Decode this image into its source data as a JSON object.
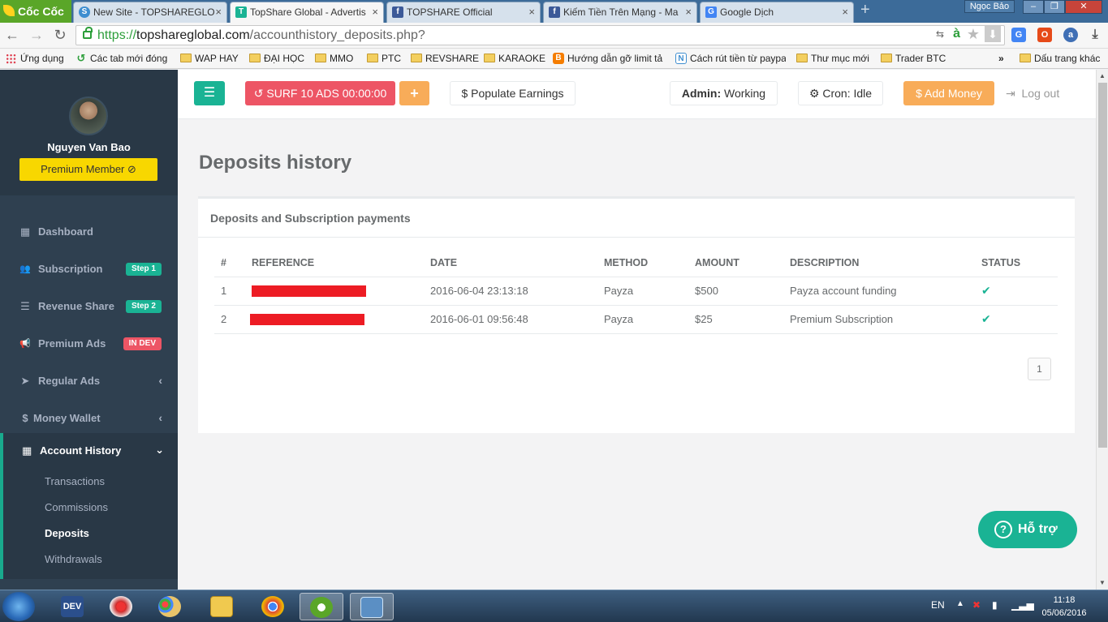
{
  "browser": {
    "brand": "Cốc Cốc",
    "tabs": [
      {
        "title": "New Site - TOPSHAREGLO",
        "fav": "S",
        "color": "#3e8ed0",
        "active": false
      },
      {
        "title": "TopShare Global - Advertis",
        "fav": "T",
        "color": "#1ab394",
        "active": true
      },
      {
        "title": "TOPSHARE Official",
        "fav": "f",
        "color": "#3b5998",
        "active": false
      },
      {
        "title": "Kiếm Tiền Trên Mạng - Ma",
        "fav": "f",
        "color": "#3b5998",
        "active": false
      },
      {
        "title": "Google Dịch",
        "fav": "G",
        "color": "#4285f4",
        "active": false
      }
    ],
    "window_user": "Ngọc Bảo",
    "url_scheme": "https://",
    "url_host": "topshareglobal.com",
    "url_path": "/accounthistory_deposits.php?",
    "bookmarks": [
      {
        "label": "Ứng dụng",
        "kind": "apps"
      },
      {
        "label": "Các tab mới đóng",
        "kind": "history"
      },
      {
        "label": "WAP HAY",
        "kind": "folder"
      },
      {
        "label": "ĐẠI HỌC",
        "kind": "folder"
      },
      {
        "label": "MMO",
        "kind": "folder"
      },
      {
        "label": "PTC",
        "kind": "folder"
      },
      {
        "label": "REVSHARE",
        "kind": "folder"
      },
      {
        "label": "KARAOKE",
        "kind": "folder"
      },
      {
        "label": "Hướng dẫn gỡ limit tả",
        "kind": "blogger"
      },
      {
        "label": "Cách rút tiền từ paypa",
        "kind": "link"
      },
      {
        "label": "Thư mục mới",
        "kind": "folder"
      },
      {
        "label": "Trader BTC",
        "kind": "folder"
      }
    ],
    "bookmarks_more": "»",
    "other_bookmarks": "Dấu trang khác"
  },
  "sidebar": {
    "user_name": "Nguyen Van Bao",
    "member_badge": "Premium Member",
    "menu": [
      {
        "label": "Dashboard",
        "icon": "dashboard-icon",
        "glyph": "▦",
        "badge": ""
      },
      {
        "label": "Subscription",
        "icon": "users-icon",
        "glyph": "👥",
        "badge": "Step 1",
        "badge_color": "green"
      },
      {
        "label": "Revenue Share",
        "icon": "list-icon",
        "glyph": "☰",
        "badge": "Step 2",
        "badge_color": "green"
      },
      {
        "label": "Premium Ads",
        "icon": "bullhorn-icon",
        "glyph": "📢",
        "badge": "IN DEV",
        "badge_color": "red"
      },
      {
        "label": "Regular Ads",
        "icon": "paper-plane-icon",
        "glyph": "➤",
        "chevron": "‹"
      },
      {
        "label": "Money Wallet",
        "icon": "dollar-icon",
        "glyph": "$",
        "chevron": "‹"
      }
    ],
    "active_section": {
      "label": "Account History",
      "chevron": "⌄",
      "items": [
        "Transactions",
        "Commissions",
        "Deposits",
        "Withdrawals"
      ],
      "current": "Deposits"
    }
  },
  "topnav": {
    "surf_label": "SURF 10 ADS 00:00:00",
    "plus_label": "+",
    "populate_label": "Populate Earnings",
    "admin_key": "Admin:",
    "admin_value": "Working",
    "cron_label": "Cron: Idle",
    "add_money_label": "Add Money",
    "logout_label": "Log out"
  },
  "page": {
    "title": "Deposits history",
    "panel_title": "Deposits and Subscription payments",
    "columns": [
      "#",
      "REFERENCE",
      "DATE",
      "METHOD",
      "AMOUNT",
      "DESCRIPTION",
      "STATUS"
    ],
    "rows": [
      {
        "num": "1",
        "reference": "",
        "date": "2016-06-04 23:13:18",
        "method": "Payza",
        "amount": "$500",
        "description": "Payza account funding",
        "status": "✔"
      },
      {
        "num": "2",
        "reference": "",
        "date": "2016-06-01 09:56:48",
        "method": "Payza",
        "amount": "$25",
        "description": "Premium Subscription",
        "status": "✔"
      }
    ],
    "pagination_current": "1",
    "support_label": "Hỗ trợ",
    "support_glyph": "?"
  },
  "taskbar": {
    "apps": [
      "DEV C++",
      "CCleaner",
      "Paint",
      "Explorer",
      "Chrome",
      "Cốc Cốc",
      "Control Panel"
    ],
    "apps_first_label": "DEV",
    "language": "EN",
    "time": "11:18",
    "date": "05/06/2016"
  },
  "colors": {
    "accent": "#1ab394",
    "danger": "#ed5565",
    "warning": "#f8ac59",
    "sidebar": "#2f4050",
    "premium": "#f8d700"
  }
}
